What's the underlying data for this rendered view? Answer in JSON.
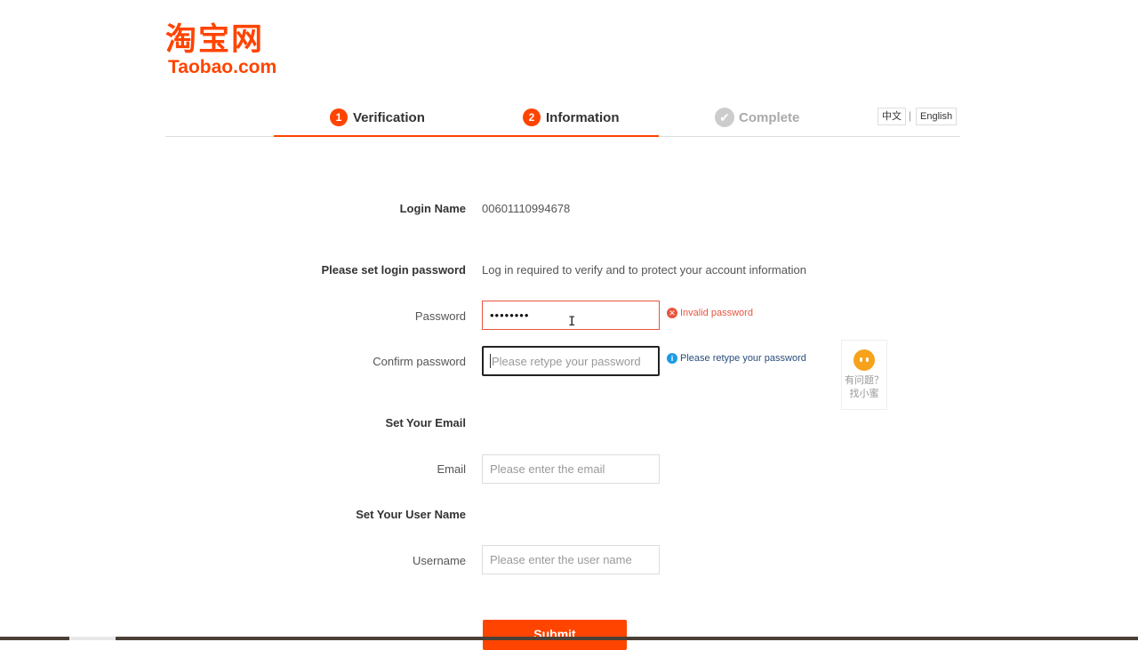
{
  "logo": {
    "cn": "淘宝网",
    "en": "Taobao.com"
  },
  "steps": [
    {
      "num": "1",
      "label": "Verification"
    },
    {
      "num": "2",
      "label": "Information"
    },
    {
      "icon": "check-icon",
      "label": "Complete"
    }
  ],
  "lang": {
    "cn": "中文",
    "sep": "|",
    "en": "English"
  },
  "form": {
    "login_name_label": "Login Name",
    "login_name_value": "00601110994678",
    "set_password_label": "Please set login password",
    "set_password_desc": "Log in required to verify and to protect your account information",
    "password_label": "Password",
    "password_value": "••••••••",
    "password_error": "Invalid password",
    "confirm_label": "Confirm password",
    "confirm_placeholder": "Please retype your password",
    "confirm_hint": "Please retype your password",
    "set_email_label": "Set Your Email",
    "email_label": "Email",
    "email_placeholder": "Please enter the email",
    "set_username_label": "Set Your User Name",
    "username_label": "Username",
    "username_placeholder": "Please enter the user name",
    "submit_label": "Submit"
  },
  "helper": {
    "line1": "有问题？",
    "line2": "找小蜜"
  },
  "colors": {
    "brand": "#ff4400",
    "error": "#e8553e",
    "info": "#1a9be8"
  }
}
